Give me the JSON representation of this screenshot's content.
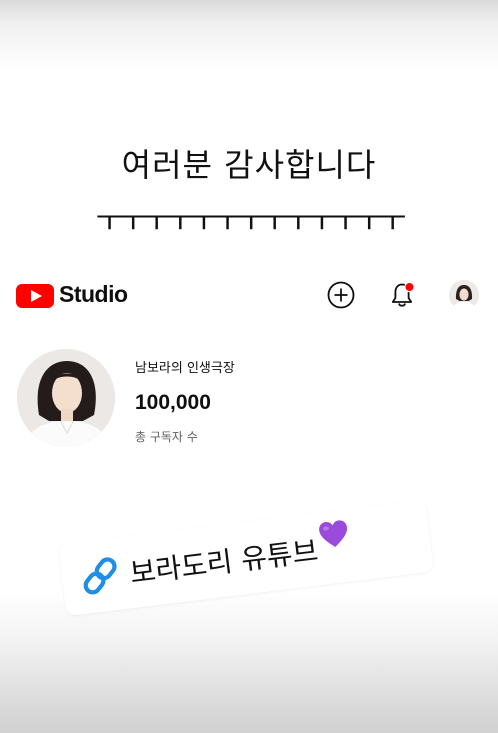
{
  "caption": {
    "line1": "여러분 감사합니다",
    "line2": "ㅜㅜㅜㅜㅜㅜㅜㅜㅜㅜㅜㅜㅜ"
  },
  "header": {
    "logo_text": "Studio",
    "icons": [
      "youtube-logo-icon",
      "add-icon",
      "notification-bell-icon",
      "account-avatar"
    ],
    "notification_dot_color": "#ff0000"
  },
  "channel": {
    "name": "남보라의 인생극장",
    "subscriber_count": "100,000",
    "subscriber_label": "총 구독자 수"
  },
  "link_sticker": {
    "text": "보라도리 유튜브",
    "icon": "link-icon",
    "emoji": "purple-heart",
    "icon_color": "#1e8ee6",
    "heart_color": "#9b4bdc"
  },
  "colors": {
    "brand_red": "#ff0000",
    "text_primary": "#0f0f0f",
    "text_secondary": "#606060"
  }
}
